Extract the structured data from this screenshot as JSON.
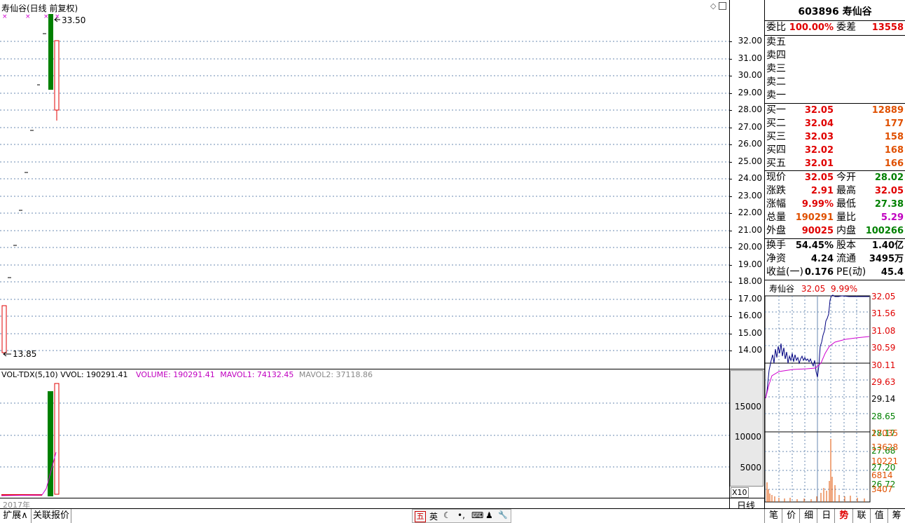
{
  "chart_header": {
    "title": "寿仙谷(日线 前复权)",
    "high_label": "33.50",
    "low_label": "13.85",
    "year_label": "2017年",
    "period_label": "日线",
    "corner_label": "X10"
  },
  "price_axis": [
    "32.00",
    "31.00",
    "30.00",
    "29.00",
    "28.00",
    "27.00",
    "26.00",
    "25.00",
    "24.00",
    "23.00",
    "22.00",
    "21.00",
    "20.00",
    "19.00",
    "18.00",
    "17.00",
    "16.00",
    "15.00",
    "14.00"
  ],
  "volume_axis": [
    "15000",
    "10000",
    "5000"
  ],
  "volume_header": {
    "name": "VOL-TDX(5,10)",
    "vvol": "VVOL: 190291.41",
    "volume": "VOLUME: 190291.41",
    "mavol1": "MAVOL1: 74132.45",
    "mavol2": "MAVOL2: 37118.86"
  },
  "quote": {
    "code_name": "603896 寿仙谷",
    "weibi_label": "委比",
    "weibi": "100.00%",
    "weicha_label": "委差",
    "weicha": "13558",
    "sell": [
      {
        "label": "卖五",
        "price": "",
        "vol": ""
      },
      {
        "label": "卖四",
        "price": "",
        "vol": ""
      },
      {
        "label": "卖三",
        "price": "",
        "vol": ""
      },
      {
        "label": "卖二",
        "price": "",
        "vol": ""
      },
      {
        "label": "卖一",
        "price": "",
        "vol": ""
      }
    ],
    "buy": [
      {
        "label": "买一",
        "price": "32.05",
        "vol": "12889"
      },
      {
        "label": "买二",
        "price": "32.04",
        "vol": "177"
      },
      {
        "label": "买三",
        "price": "32.03",
        "vol": "158"
      },
      {
        "label": "买四",
        "price": "32.02",
        "vol": "168"
      },
      {
        "label": "买五",
        "price": "32.01",
        "vol": "166"
      }
    ],
    "stats": [
      {
        "l1": "现价",
        "v1": "32.05",
        "c1": "red",
        "l2": "今开",
        "v2": "28.02",
        "c2": "green"
      },
      {
        "l1": "涨跌",
        "v1": "2.91",
        "c1": "red",
        "l2": "最高",
        "v2": "32.05",
        "c2": "red"
      },
      {
        "l1": "涨幅",
        "v1": "9.99%",
        "c1": "red",
        "l2": "最低",
        "v2": "27.38",
        "c2": "green"
      },
      {
        "l1": "总量",
        "v1": "190291",
        "c1": "orange",
        "l2": "量比",
        "v2": "5.29",
        "c2": "magenta"
      },
      {
        "l1": "外盘",
        "v1": "90025",
        "c1": "red",
        "l2": "内盘",
        "v2": "100266",
        "c2": "green"
      }
    ],
    "stats2": [
      {
        "l1": "换手",
        "v1": "54.45%",
        "l2": "股本",
        "v2": "1.40亿"
      },
      {
        "l1": "净资",
        "v1": "4.24",
        "l2": "流通",
        "v2": "3495万"
      },
      {
        "l1": "收益(一)",
        "v1": "0.176",
        "l2": "PE(动)",
        "v2": "45.4"
      }
    ]
  },
  "intraday": {
    "name": "寿仙谷",
    "price": "32.05",
    "pct": "9.99%",
    "price_axis": [
      {
        "v": "32.05",
        "c": "#e00000"
      },
      {
        "v": "31.56",
        "c": "#e00000"
      },
      {
        "v": "31.08",
        "c": "#e00000"
      },
      {
        "v": "30.59",
        "c": "#e00000"
      },
      {
        "v": "30.11",
        "c": "#e00000"
      },
      {
        "v": "29.63",
        "c": "#e00000"
      },
      {
        "v": "29.14",
        "c": "#000000"
      },
      {
        "v": "28.65",
        "c": "#008000"
      },
      {
        "v": "28.17",
        "c": "#008000"
      },
      {
        "v": "27.68",
        "c": "#008000"
      },
      {
        "v": "27.20",
        "c": "#008000"
      },
      {
        "v": "26.72",
        "c": "#008000"
      }
    ],
    "vol_axis": [
      "17035",
      "13628",
      "10221",
      "6814",
      "3407"
    ]
  },
  "bottom_tabs": [
    "扩展∧",
    "关联报价"
  ],
  "right_tabs": [
    "笔",
    "价",
    "细",
    "日",
    "势",
    "联",
    "值",
    "筹"
  ],
  "active_right_tab": "势",
  "ime_items": [
    "五",
    "英",
    "☾",
    "•,",
    "⌨",
    "♟",
    "🔧"
  ]
}
